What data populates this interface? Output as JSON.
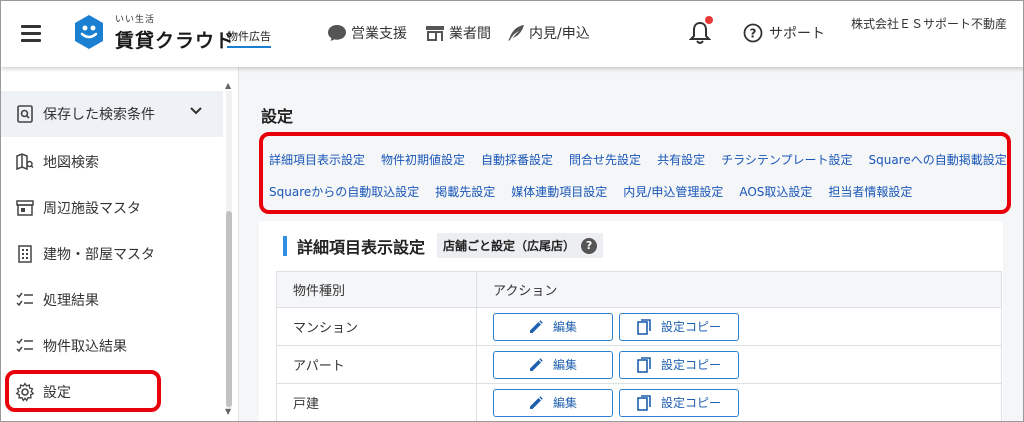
{
  "header": {
    "logo_sub": "いい生活",
    "logo_main": "賃貸クラウド",
    "logo_tag": "物件広告",
    "nav": [
      {
        "label": "営業支援",
        "icon": "chat-bubble-icon"
      },
      {
        "label": "業者間",
        "icon": "storefront-icon"
      },
      {
        "label": "内見/申込",
        "icon": "feather-pen-icon"
      }
    ],
    "support_label": "サポート",
    "company": "株式会社ＥＳサポート不動産"
  },
  "sidebar": {
    "items": [
      {
        "label": "保存した検索条件",
        "icon": "saved-search-icon"
      },
      {
        "label": "地図検索",
        "icon": "map-search-icon"
      },
      {
        "label": "周辺施設マスタ",
        "icon": "facility-icon"
      },
      {
        "label": "建物・部屋マスタ",
        "icon": "building-icon"
      },
      {
        "label": "処理結果",
        "icon": "checklist-icon"
      },
      {
        "label": "物件取込結果",
        "icon": "checklist-icon"
      },
      {
        "label": "設定",
        "icon": "gear-icon"
      }
    ]
  },
  "main": {
    "title": "設定",
    "links_row1": [
      "詳細項目表示設定",
      "物件初期値設定",
      "自動採番設定",
      "問合せ先設定",
      "共有設定",
      "チラシテンプレート設定",
      "Squareへの自動掲載設定"
    ],
    "links_row2": [
      "Squareからの自動取込設定",
      "掲載先設定",
      "媒体連動項目設定",
      "内見/申込管理設定",
      "AOS取込設定",
      "担当者情報設定"
    ],
    "section_title": "詳細項目表示設定",
    "store_badge": "店舗ごと設定（広尾店）",
    "help_icon_glyph": "?",
    "table": {
      "headers": [
        "物件種別",
        "アクション"
      ],
      "rows": [
        "マンション",
        "アパート",
        "戸建"
      ],
      "edit_label": "編集",
      "copy_label": "設定コピー"
    }
  },
  "colors": {
    "accent": "#2f8fe0",
    "link": "#1a56b8",
    "highlight": "#e8000b",
    "notification": "#e53935"
  }
}
